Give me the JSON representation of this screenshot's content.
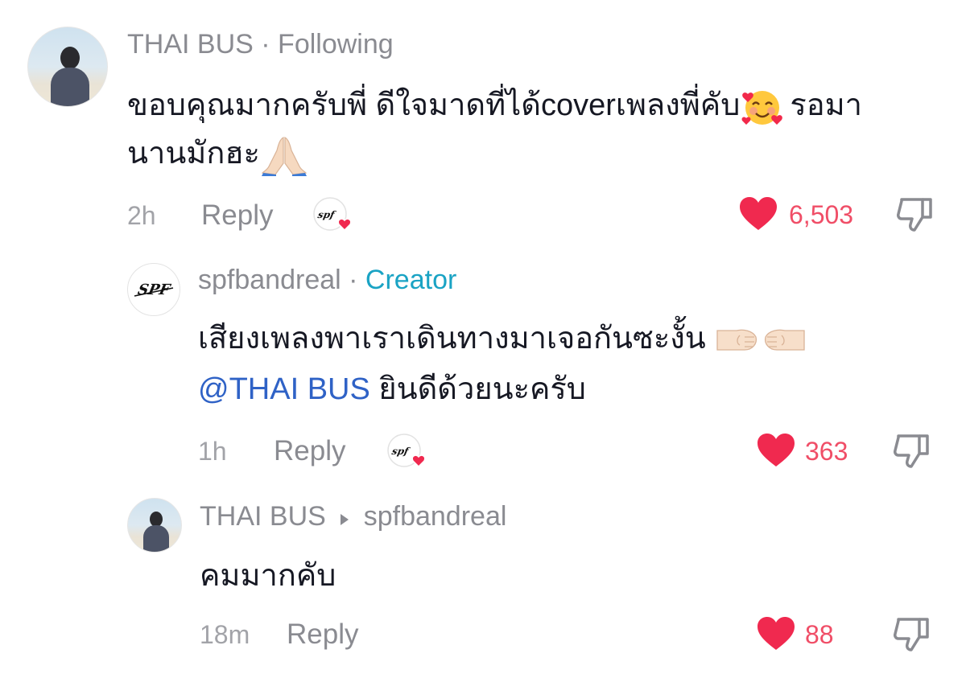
{
  "comments": [
    {
      "username": "THAI BUS",
      "separator": "·",
      "status": "Following",
      "text_line1": "ขอบคุณมากครับพี่ ดีใจมาดที่ได้coverเพลงพี่คับ",
      "text_line1_tail": "รอมา",
      "text_line2": "นานมักฮะ",
      "time": "2h",
      "reply_label": "Reply",
      "likes": "6,503"
    },
    {
      "username": "spfbandreal",
      "separator": "·",
      "badge": "Creator",
      "text_line1": "เสียงเพลงพาเราเดินทางมาเจอกันซะงั้น",
      "mention": "@THAI BUS",
      "text_line2": "ยินดีด้วยนะครับ",
      "time": "1h",
      "reply_label": "Reply",
      "likes": "363"
    },
    {
      "username": "THAI BUS",
      "reply_to": "spfbandreal",
      "text_line1": "คมมากคับ",
      "time": "18m",
      "reply_label": "Reply",
      "likes": "88"
    }
  ],
  "avatar_logo_text": "SPF",
  "icons": {
    "like": "heart-icon",
    "dislike": "thumbs-down-icon",
    "reply_arrow": "triangle-right-icon",
    "emoji_smiling_hearts": "smiling-face-with-hearts-icon",
    "emoji_pray": "folded-hands-icon",
    "emoji_fist_left": "left-facing-fist-icon",
    "emoji_fist_right": "right-facing-fist-icon",
    "creator_liked": "creator-liked-badge-icon"
  },
  "colors": {
    "heart": "#f0294f",
    "count": "#f04e67",
    "creator": "#1aa3c4",
    "mention": "#2f62c6",
    "muted": "#8a8b91"
  }
}
